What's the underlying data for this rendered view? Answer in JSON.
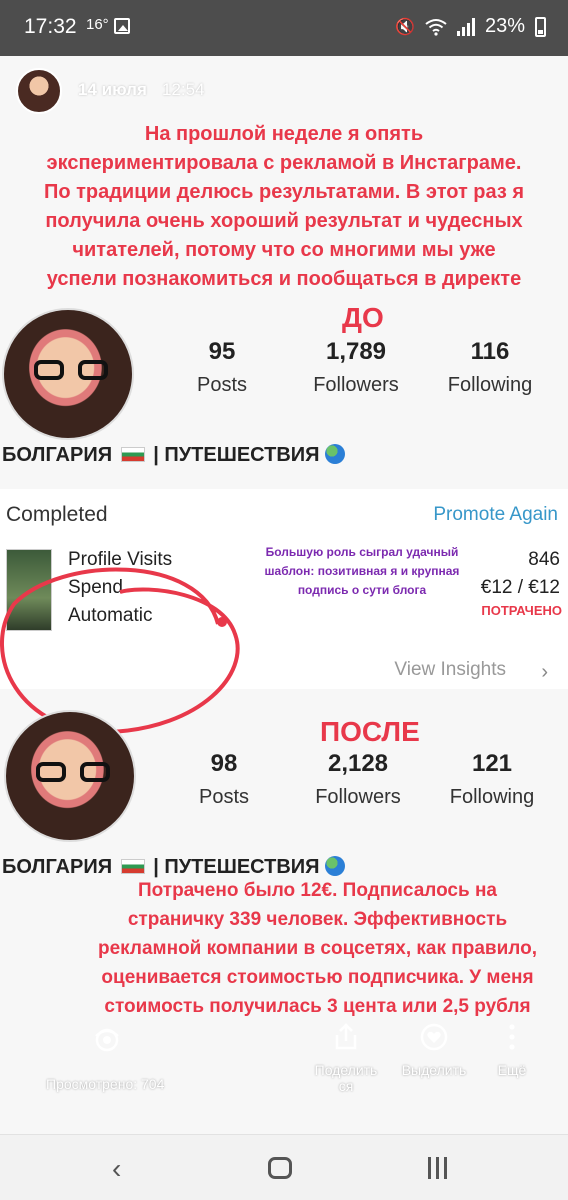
{
  "status_bar": {
    "time": "17:32",
    "temperature": "16°",
    "battery": "23%"
  },
  "story": {
    "date": "14 июля",
    "time": "12:54",
    "intro_caption": [
      "На прошлой неделе я опять",
      "экспериментировала с рекламой в Инстаграме.",
      "По традиции делюсь результатами. В этот раз я",
      "получила очень хороший результат и чудесных",
      "читателей, потому что со многими мы уже",
      "успели познакомиться и пообщаться в директе"
    ],
    "before": {
      "label": "ДО",
      "posts": "95",
      "posts_label": "Posts",
      "followers": "1,789",
      "followers_label": "Followers",
      "following": "116",
      "following_label": "Following",
      "bio": "БОЛГАРИЯ",
      "bio_sep": "| ПУТЕШЕСТВИЯ"
    },
    "promotion": {
      "status": "Completed",
      "promote_again": "Promote Again",
      "rows": [
        "Profile Visits",
        "Spend",
        "Automatic"
      ],
      "visits_value": "846",
      "spend_value": "€12 / €12",
      "spent_label": "ПОТРАЧЕНО",
      "view_insights": "View Insights",
      "note": "Большую роль сыграл удачный шаблон: позитивная я и крупная подпись о сути блога"
    },
    "after": {
      "label": "ПОСЛЕ",
      "posts": "98",
      "posts_label": "Posts",
      "followers": "2,128",
      "followers_label": "Followers",
      "following": "121",
      "following_label": "Following",
      "bio": "БОЛГАРИЯ",
      "bio_sep": "| ПУТЕШЕСТВИЯ"
    },
    "outro_caption": [
      "Потрачено было 12€. Подписалось на",
      "страничку 339 человек. Эффективность",
      "рекламной компании в соцсетях, как правило,",
      "оценивается стоимостью подписчика. У меня",
      "стоимость получилась 3 цента или 2,5 рубля"
    ]
  },
  "footer": {
    "viewed": "Просмотрено: 704",
    "share_line1": "Поделить",
    "share_line2": "ся",
    "highlight": "Выделить",
    "more": "Ещё"
  },
  "colors": {
    "caption_red": "#e8384a",
    "link_blue": "#3797c9",
    "note_purple": "#7c2ab0"
  }
}
